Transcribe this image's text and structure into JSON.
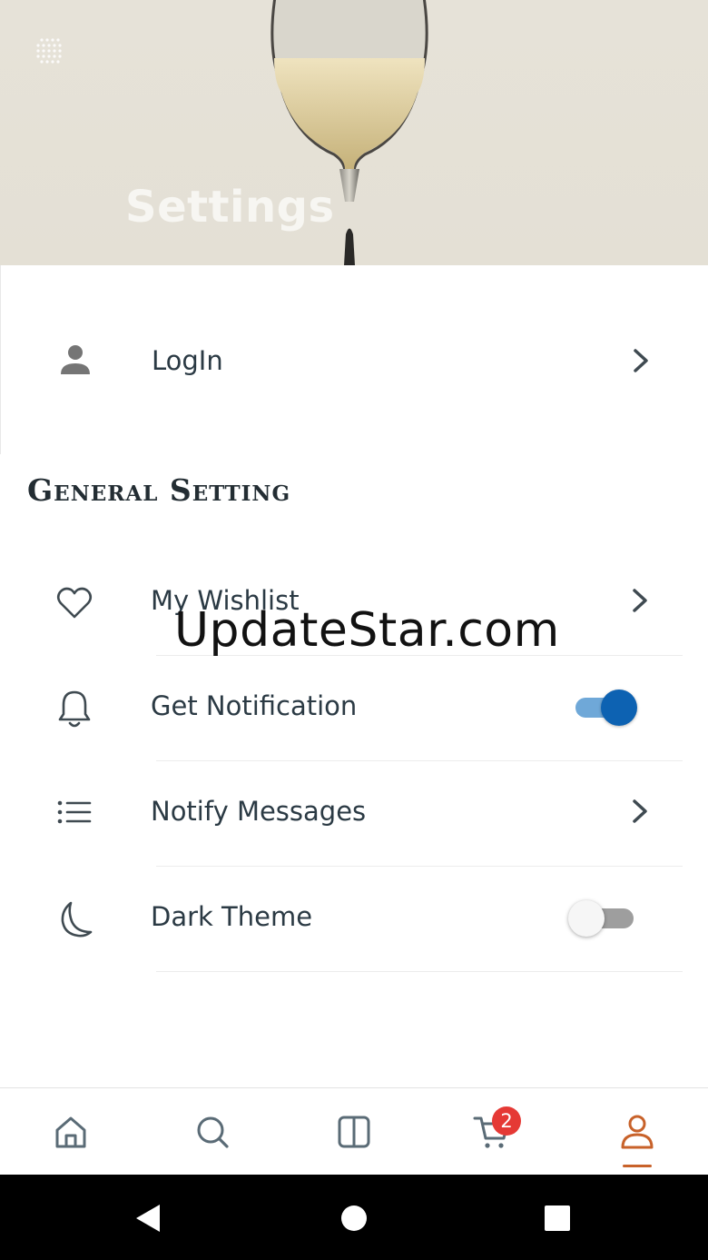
{
  "header": {
    "title": "Settings"
  },
  "login": {
    "label": "LogIn"
  },
  "general": {
    "section_title": "General Setting",
    "items": [
      {
        "label": "My Wishlist",
        "control": "chevron",
        "icon": "heart-icon"
      },
      {
        "label": "Get Notification",
        "control": "toggle",
        "on": true,
        "icon": "bell-icon"
      },
      {
        "label": "Notify Messages",
        "control": "chevron",
        "icon": "list-icon"
      },
      {
        "label": "Dark Theme",
        "control": "toggle",
        "on": false,
        "icon": "moon-icon"
      }
    ]
  },
  "watermark": "UpdateStar.com",
  "bottom_nav": {
    "items": [
      "home-icon",
      "search-icon",
      "categories-icon",
      "cart-icon",
      "profile-icon"
    ],
    "cart_badge": "2",
    "active": "profile-icon",
    "active_color": "#c8622a"
  },
  "colors": {
    "toggle_on": "#0d62b2",
    "badge": "#e53935"
  }
}
